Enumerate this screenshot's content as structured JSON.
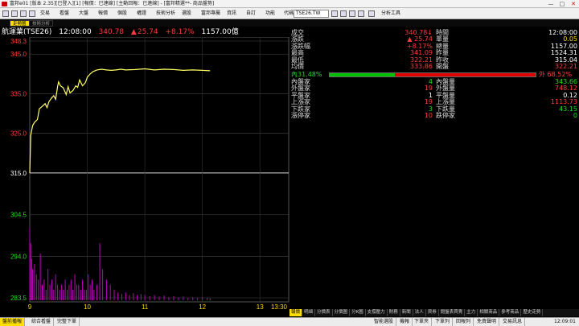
{
  "window": {
    "title": "富邦e01 [版本 2.35][已登入][1] [報價：已連線] [主動回報：已連線] - [富邦精選**- 商品盤勢]",
    "minimize": "—",
    "maximize": "□",
    "close": "✕"
  },
  "toolbar": {
    "menus": [
      "交易",
      "看盤",
      "大盤",
      "報價",
      "個股",
      "權證",
      "技術分析",
      "選股",
      "富邦專屬",
      "資訊",
      "自訂",
      "功能"
    ],
    "symbol_label": "代碼",
    "symbol_value": "TSE26.TW",
    "tool_label": "分析工具"
  },
  "tabs": {
    "active": "走勢圖",
    "other": "技術分析"
  },
  "header": {
    "name": "航運業(TSE26)",
    "time": "12:08:00",
    "price": "340.78",
    "change_arrow": "▲",
    "change": "25.74",
    "change_pct": "+8.17%",
    "volume": "1157.00億"
  },
  "chart_data": {
    "type": "line",
    "title": "",
    "ylim": [
      283.5,
      348.3
    ],
    "reference": 315.0,
    "price_ticks": [
      "348.3",
      "345.0",
      "335.0",
      "325.0",
      "315.0",
      "304.5",
      "294.0",
      "283.5"
    ],
    "price_tick_values": [
      348.3,
      345.0,
      335.0,
      325.0,
      315.0,
      304.5,
      294.0,
      283.5
    ],
    "x_ticks": [
      "9",
      "10",
      "11",
      "12",
      "13",
      "13:30"
    ],
    "x_tick_values": [
      0,
      60,
      120,
      180,
      240,
      270
    ],
    "x_minutes": [
      0,
      1,
      3,
      5,
      8,
      10,
      13,
      16,
      18,
      20,
      23,
      25,
      27,
      29,
      30,
      32,
      35,
      38,
      40,
      42,
      45,
      48,
      50,
      52,
      55,
      58,
      60,
      63,
      66,
      70,
      75,
      80,
      85,
      90,
      95,
      100,
      110,
      120,
      130,
      140,
      150,
      160,
      170,
      180,
      188
    ],
    "price": [
      315.0,
      324.5,
      327.0,
      327.8,
      328.5,
      331.2,
      331.8,
      332.5,
      331.5,
      333.0,
      334.0,
      334.5,
      333.6,
      336.8,
      338.0,
      337.0,
      336.5,
      334.8,
      336.8,
      335.2,
      335.8,
      337.0,
      336.6,
      338.5,
      337.0,
      337.8,
      339.2,
      340.0,
      340.6,
      341.0,
      341.2,
      341.0,
      340.9,
      341.0,
      341.2,
      341.0,
      341.1,
      341.3,
      341.0,
      341.2,
      341.1,
      340.9,
      341.0,
      340.9,
      340.8
    ],
    "volume_minutes": [
      0,
      1,
      2,
      3,
      5,
      7,
      9,
      11,
      13,
      15,
      17,
      19,
      21,
      23,
      25,
      27,
      29,
      31,
      33,
      35,
      37,
      39,
      41,
      43,
      45,
      47,
      49,
      51,
      53,
      55,
      57,
      59,
      61,
      63,
      65,
      67,
      70,
      73,
      76,
      80,
      84,
      88,
      92,
      96,
      100,
      104,
      108,
      112,
      116,
      120,
      125,
      130,
      135,
      140,
      145,
      150,
      155,
      160,
      165,
      170,
      175,
      180,
      185,
      188
    ],
    "volume": [
      14,
      11,
      8,
      6,
      7,
      5,
      4,
      9,
      3,
      4,
      2,
      6,
      3,
      4,
      2,
      5,
      3,
      2,
      3,
      2,
      4,
      2,
      3,
      4,
      2,
      5,
      3,
      3,
      2,
      4,
      2,
      2,
      5,
      3,
      4,
      2,
      3,
      11,
      6,
      4,
      3,
      2,
      1.5,
      1.2,
      1.5,
      1.0,
      1.4,
      1.0,
      1.2,
      1.0,
      0.8,
      1.0,
      0.7,
      0.9,
      0.6,
      0.8,
      0.6,
      0.7,
      0.5,
      0.6,
      0.5,
      0.6,
      0.5,
      0.4
    ]
  },
  "quote": {
    "left": [
      {
        "label": "成交",
        "value": "340.78↓",
        "color": "#ff3b3b"
      },
      {
        "label": "漲跌",
        "value": "▲ 25.74",
        "color": "#ff3b3b"
      },
      {
        "label": "漲跌幅",
        "value": "+8.17%",
        "color": "#ff3b3b"
      },
      {
        "label": "最高",
        "value": "341.09",
        "color": "#ff3b3b"
      },
      {
        "label": "最低",
        "value": "322.21",
        "color": "#ff3b3b"
      },
      {
        "label": "均價",
        "value": "333.86",
        "color": "#ff3b3b"
      }
    ],
    "right": [
      {
        "label": "時間",
        "value": "12:08:00",
        "color": "#ffffff"
      },
      {
        "label": "單量",
        "value": "0.05",
        "color": "#ffd800"
      },
      {
        "label": "總量",
        "value": "1157.00",
        "color": "#ffffff"
      },
      {
        "label": "昨量",
        "value": "1524.31",
        "color": "#ffffff"
      },
      {
        "label": "昨收",
        "value": "315.04",
        "color": "#ffffff"
      },
      {
        "label": "開盤",
        "value": "322.21",
        "color": "#ff3b3b"
      }
    ],
    "ratio": {
      "in_label": "內31.48%",
      "out_label": "外 68.52%",
      "in_pct": 31.48,
      "out_pct": 68.52
    },
    "left2": [
      {
        "label": "內盤家",
        "value": "4",
        "color": "#22dd22"
      },
      {
        "label": "外盤家",
        "value": "19",
        "color": "#ff3b3b"
      },
      {
        "label": "平盤家",
        "value": "1",
        "color": "#ffffff"
      },
      {
        "label": "上漲家",
        "value": "19",
        "color": "#ff3b3b"
      },
      {
        "label": "下跌家",
        "value": "3",
        "color": "#22dd22"
      },
      {
        "label": "漲停家",
        "value": "10",
        "color": "#ff3b3b"
      }
    ],
    "right2": [
      {
        "label": "內盤量",
        "value": "343.66",
        "color": "#22dd22"
      },
      {
        "label": "外盤量",
        "value": "748.12",
        "color": "#ff3b3b"
      },
      {
        "label": "平盤量",
        "value": "0.12",
        "color": "#ffffff"
      },
      {
        "label": "上漲量",
        "value": "1113.73",
        "color": "#ff3b3b"
      },
      {
        "label": "下跌量",
        "value": "43.15",
        "color": "#22dd22"
      },
      {
        "label": "跌停家",
        "value": "0",
        "color": "#22dd22"
      }
    ]
  },
  "bottom_tabs": [
    "報價",
    "明細",
    "分價表",
    "分價圖",
    "分K圖",
    "支撐壓力",
    "財務",
    "新聞",
    "法人",
    "資券",
    "閱盤表買賣",
    "主力",
    "相關商品",
    "參考商品",
    "歷史走勢"
  ],
  "status": {
    "items": [
      "盤前播報",
      "綜合看盤",
      "完整下單"
    ],
    "right_items": [
      "智能選股",
      "機報",
      "下單夾",
      "下單列",
      "回報列",
      "免責聲明",
      "交易訊息"
    ],
    "clock": "12:09:01"
  }
}
